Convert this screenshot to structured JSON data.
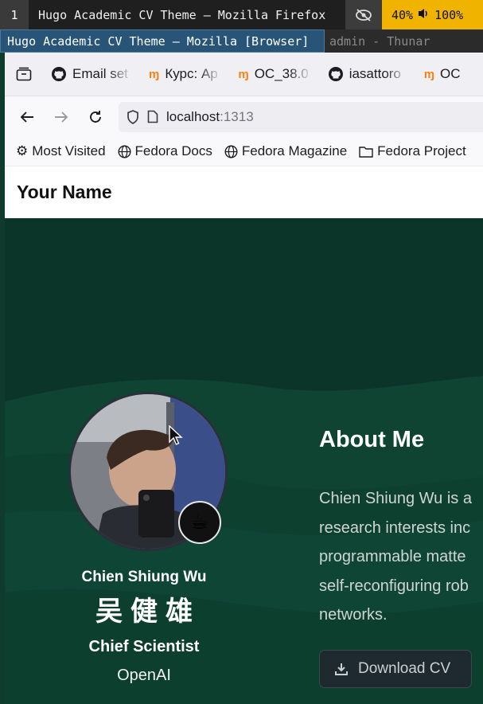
{
  "wm": {
    "workspace": "1",
    "window_title": "Hugo Academic CV Theme — Mozilla Firefox",
    "battery": "40%",
    "volume": "100%"
  },
  "wm_tabs": {
    "active": "Hugo Academic CV Theme — Mozilla [Browser]",
    "inactive": "admin - Thunar"
  },
  "browser": {
    "tabs": [
      {
        "label": "Email set",
        "icon": "github-icon"
      },
      {
        "label": "Курс: Ap",
        "icon": "moodle-icon"
      },
      {
        "label": "OC_38.0",
        "icon": "moodle-icon"
      },
      {
        "label": "iasattoro",
        "icon": "github-icon"
      },
      {
        "label": "OC",
        "icon": "moodle-icon"
      }
    ],
    "url_host": "localhost",
    "url_port": ":1313",
    "bookmarks": [
      {
        "label": "Most Visited",
        "icon": "gear-icon"
      },
      {
        "label": "Fedora Docs",
        "icon": "globe-icon"
      },
      {
        "label": "Fedora Magazine",
        "icon": "globe-icon"
      },
      {
        "label": "Fedora Project",
        "icon": "folder-icon"
      }
    ]
  },
  "site": {
    "brand": "Your Name"
  },
  "profile": {
    "name": "Chien Shiung Wu",
    "name_cn": "吴健雄",
    "role": "Chief Scientist",
    "organization": "OpenAI",
    "status_emoji": "☕"
  },
  "about": {
    "title": "About Me",
    "lines": [
      "Chien Shiung Wu is a",
      "research interests inc",
      "programmable matte",
      "self-reconfiguring rob",
      "networks."
    ],
    "download_label": "Download CV"
  },
  "colors": {
    "hero_bg": "#0c3a2b",
    "status_yellow": "#f0b400",
    "active_tab": "#285577"
  }
}
